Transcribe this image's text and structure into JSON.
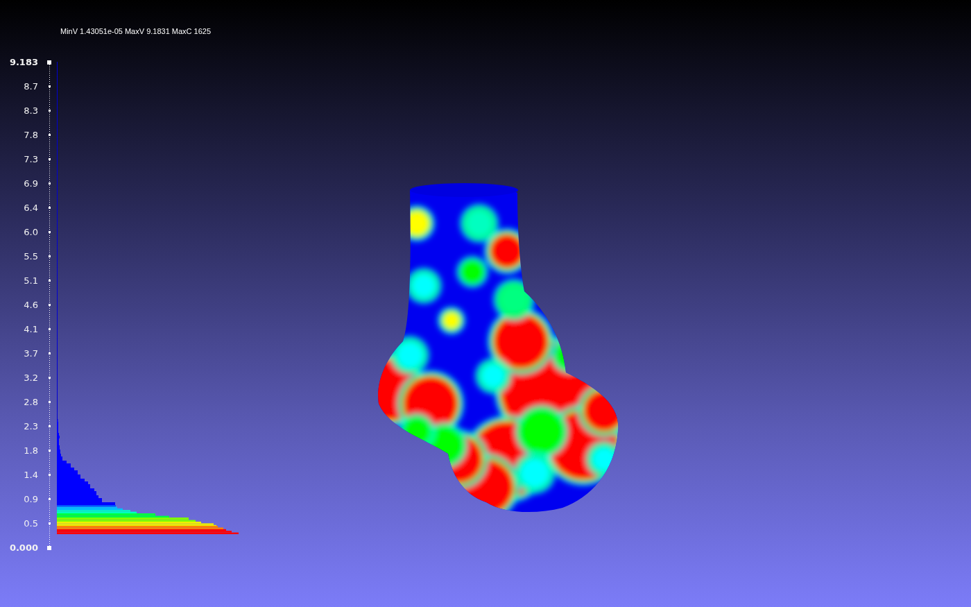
{
  "viewport": {
    "info": "MinV 1.43051e-05 MaxV 9.1831 MaxC 1625"
  },
  "scale": {
    "labels": [
      {
        "text": "9.183",
        "kind": "bound"
      },
      {
        "text": "8.7",
        "kind": "tick"
      },
      {
        "text": "8.3",
        "kind": "tick"
      },
      {
        "text": "7.8",
        "kind": "tick"
      },
      {
        "text": "7.3",
        "kind": "tick"
      },
      {
        "text": "6.9",
        "kind": "tick"
      },
      {
        "text": "6.4",
        "kind": "tick"
      },
      {
        "text": "6.0",
        "kind": "tick"
      },
      {
        "text": "5.5",
        "kind": "tick"
      },
      {
        "text": "5.1",
        "kind": "tick"
      },
      {
        "text": "4.6",
        "kind": "tick"
      },
      {
        "text": "4.1",
        "kind": "tick"
      },
      {
        "text": "3.7",
        "kind": "tick"
      },
      {
        "text": "3.2",
        "kind": "tick"
      },
      {
        "text": "2.8",
        "kind": "tick"
      },
      {
        "text": "2.3",
        "kind": "tick"
      },
      {
        "text": "1.8",
        "kind": "tick"
      },
      {
        "text": "1.4",
        "kind": "tick"
      },
      {
        "text": "0.9",
        "kind": "tick"
      },
      {
        "text": "0.5",
        "kind": "tick"
      },
      {
        "text": "0.000",
        "kind": "bound"
      }
    ]
  }
}
